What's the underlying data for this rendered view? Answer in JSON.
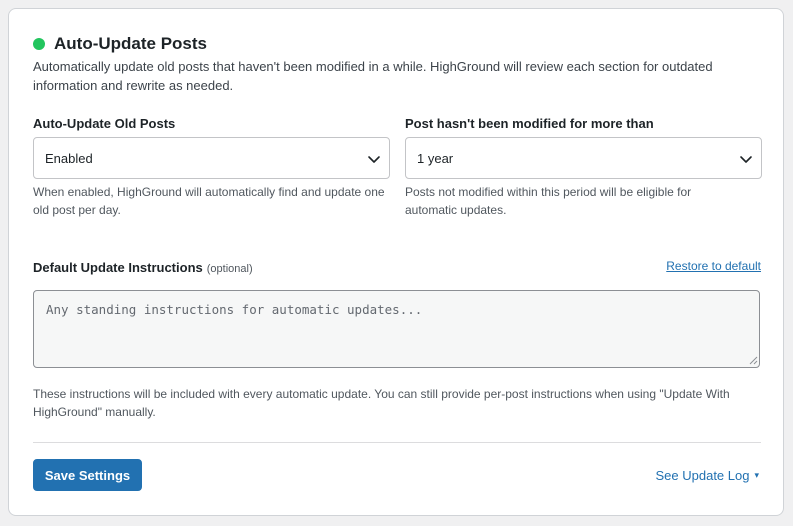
{
  "section": {
    "title": "Auto-Update Posts",
    "status_color": "#22c55e",
    "description": "Automatically update old posts that haven't been modified in a while. HighGround will review each section for outdated information and rewrite as needed."
  },
  "auto_update": {
    "label": "Auto-Update Old Posts",
    "selected": "Enabled",
    "help": "When enabled, HighGround will automatically find and update one old post per day."
  },
  "age_threshold": {
    "label": "Post hasn't been modified for more than",
    "selected": "1 year",
    "help": "Posts not modified within this period will be eligible for automatic updates."
  },
  "instructions": {
    "label": "Default Update Instructions",
    "optional_tag": "(optional)",
    "restore_link": "Restore to default",
    "placeholder": "Any standing instructions for automatic updates...",
    "value": "",
    "note": "These instructions will be included with every automatic update. You can still provide per-post instructions when using \"Update With HighGround\" manually."
  },
  "footer": {
    "save_label": "Save Settings",
    "log_link": "See Update Log",
    "log_caret": "▾"
  },
  "colors": {
    "primary": "#2271b1",
    "card_border": "#d0d3d7",
    "page_background": "#f0f0f1"
  },
  "icons": {
    "status": "status-dot-icon",
    "select_arrow": "chevron-down-icon",
    "resize": "resize-grip-icon"
  }
}
